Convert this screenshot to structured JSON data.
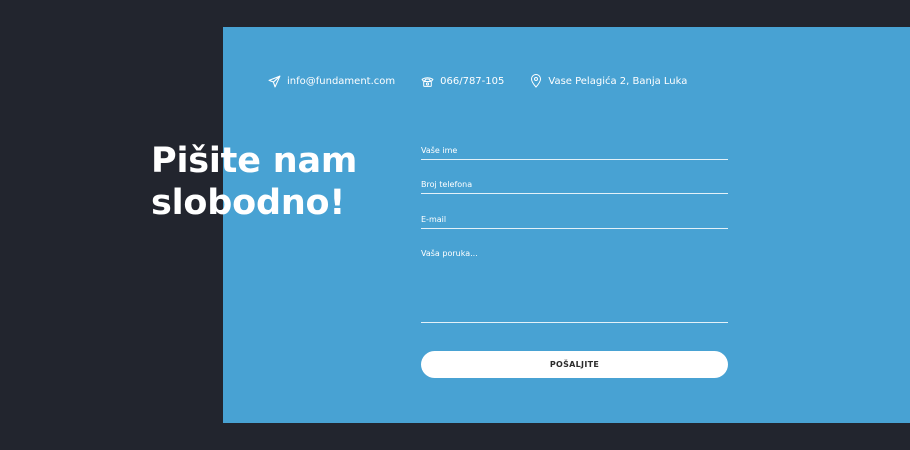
{
  "contact": {
    "email": "info@fundament.com",
    "phone": "066/787-105",
    "address": "Vase Pelagića 2, Banja Luka",
    "email_icon": "paper-plane-icon",
    "phone_icon": "telephone-icon",
    "address_icon": "map-pin-icon"
  },
  "headline": "Pišite nam\nslobodno!",
  "form": {
    "name_placeholder": "Vaše ime",
    "phone_placeholder": "Broj telefona",
    "email_placeholder": "E-mail",
    "message_placeholder": "Vaša poruka...",
    "submit_label": "POŠALJITE"
  },
  "colors": {
    "background": "#22252e",
    "panel": "#48a2d3",
    "text": "#ffffff",
    "button": "#ffffff",
    "button_text": "#2b2b2b"
  }
}
